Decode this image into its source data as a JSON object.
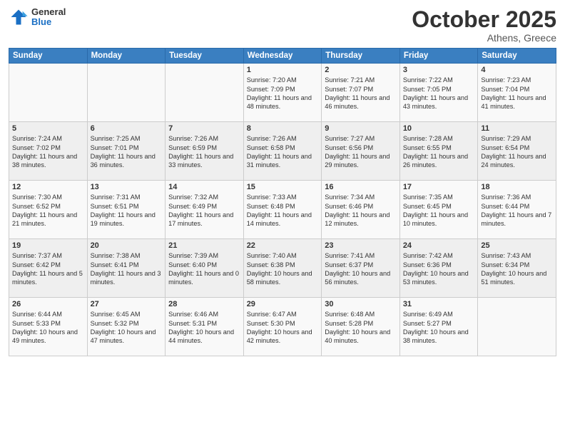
{
  "header": {
    "logo_general": "General",
    "logo_blue": "Blue",
    "month": "October 2025",
    "location": "Athens, Greece"
  },
  "days_of_week": [
    "Sunday",
    "Monday",
    "Tuesday",
    "Wednesday",
    "Thursday",
    "Friday",
    "Saturday"
  ],
  "weeks": [
    [
      {
        "day": "",
        "info": ""
      },
      {
        "day": "",
        "info": ""
      },
      {
        "day": "",
        "info": ""
      },
      {
        "day": "1",
        "info": "Sunrise: 7:20 AM\nSunset: 7:09 PM\nDaylight: 11 hours and 48 minutes."
      },
      {
        "day": "2",
        "info": "Sunrise: 7:21 AM\nSunset: 7:07 PM\nDaylight: 11 hours and 46 minutes."
      },
      {
        "day": "3",
        "info": "Sunrise: 7:22 AM\nSunset: 7:05 PM\nDaylight: 11 hours and 43 minutes."
      },
      {
        "day": "4",
        "info": "Sunrise: 7:23 AM\nSunset: 7:04 PM\nDaylight: 11 hours and 41 minutes."
      }
    ],
    [
      {
        "day": "5",
        "info": "Sunrise: 7:24 AM\nSunset: 7:02 PM\nDaylight: 11 hours and 38 minutes."
      },
      {
        "day": "6",
        "info": "Sunrise: 7:25 AM\nSunset: 7:01 PM\nDaylight: 11 hours and 36 minutes."
      },
      {
        "day": "7",
        "info": "Sunrise: 7:26 AM\nSunset: 6:59 PM\nDaylight: 11 hours and 33 minutes."
      },
      {
        "day": "8",
        "info": "Sunrise: 7:26 AM\nSunset: 6:58 PM\nDaylight: 11 hours and 31 minutes."
      },
      {
        "day": "9",
        "info": "Sunrise: 7:27 AM\nSunset: 6:56 PM\nDaylight: 11 hours and 29 minutes."
      },
      {
        "day": "10",
        "info": "Sunrise: 7:28 AM\nSunset: 6:55 PM\nDaylight: 11 hours and 26 minutes."
      },
      {
        "day": "11",
        "info": "Sunrise: 7:29 AM\nSunset: 6:54 PM\nDaylight: 11 hours and 24 minutes."
      }
    ],
    [
      {
        "day": "12",
        "info": "Sunrise: 7:30 AM\nSunset: 6:52 PM\nDaylight: 11 hours and 21 minutes."
      },
      {
        "day": "13",
        "info": "Sunrise: 7:31 AM\nSunset: 6:51 PM\nDaylight: 11 hours and 19 minutes."
      },
      {
        "day": "14",
        "info": "Sunrise: 7:32 AM\nSunset: 6:49 PM\nDaylight: 11 hours and 17 minutes."
      },
      {
        "day": "15",
        "info": "Sunrise: 7:33 AM\nSunset: 6:48 PM\nDaylight: 11 hours and 14 minutes."
      },
      {
        "day": "16",
        "info": "Sunrise: 7:34 AM\nSunset: 6:46 PM\nDaylight: 11 hours and 12 minutes."
      },
      {
        "day": "17",
        "info": "Sunrise: 7:35 AM\nSunset: 6:45 PM\nDaylight: 11 hours and 10 minutes."
      },
      {
        "day": "18",
        "info": "Sunrise: 7:36 AM\nSunset: 6:44 PM\nDaylight: 11 hours and 7 minutes."
      }
    ],
    [
      {
        "day": "19",
        "info": "Sunrise: 7:37 AM\nSunset: 6:42 PM\nDaylight: 11 hours and 5 minutes."
      },
      {
        "day": "20",
        "info": "Sunrise: 7:38 AM\nSunset: 6:41 PM\nDaylight: 11 hours and 3 minutes."
      },
      {
        "day": "21",
        "info": "Sunrise: 7:39 AM\nSunset: 6:40 PM\nDaylight: 11 hours and 0 minutes."
      },
      {
        "day": "22",
        "info": "Sunrise: 7:40 AM\nSunset: 6:38 PM\nDaylight: 10 hours and 58 minutes."
      },
      {
        "day": "23",
        "info": "Sunrise: 7:41 AM\nSunset: 6:37 PM\nDaylight: 10 hours and 56 minutes."
      },
      {
        "day": "24",
        "info": "Sunrise: 7:42 AM\nSunset: 6:36 PM\nDaylight: 10 hours and 53 minutes."
      },
      {
        "day": "25",
        "info": "Sunrise: 7:43 AM\nSunset: 6:34 PM\nDaylight: 10 hours and 51 minutes."
      }
    ],
    [
      {
        "day": "26",
        "info": "Sunrise: 6:44 AM\nSunset: 5:33 PM\nDaylight: 10 hours and 49 minutes."
      },
      {
        "day": "27",
        "info": "Sunrise: 6:45 AM\nSunset: 5:32 PM\nDaylight: 10 hours and 47 minutes."
      },
      {
        "day": "28",
        "info": "Sunrise: 6:46 AM\nSunset: 5:31 PM\nDaylight: 10 hours and 44 minutes."
      },
      {
        "day": "29",
        "info": "Sunrise: 6:47 AM\nSunset: 5:30 PM\nDaylight: 10 hours and 42 minutes."
      },
      {
        "day": "30",
        "info": "Sunrise: 6:48 AM\nSunset: 5:28 PM\nDaylight: 10 hours and 40 minutes."
      },
      {
        "day": "31",
        "info": "Sunrise: 6:49 AM\nSunset: 5:27 PM\nDaylight: 10 hours and 38 minutes."
      },
      {
        "day": "",
        "info": ""
      }
    ]
  ]
}
